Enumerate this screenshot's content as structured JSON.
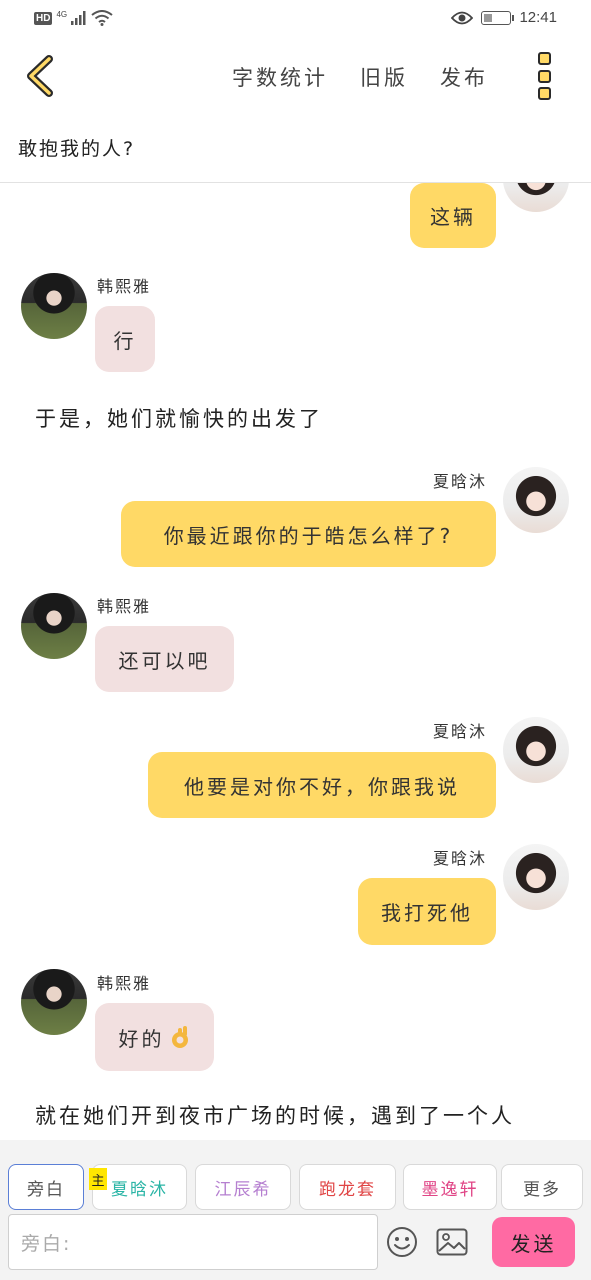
{
  "status_bar": {
    "hd": "HD",
    "network_type": "4G",
    "battery_level": 0.3,
    "battery_text": "31",
    "time": "12:41",
    "icons": [
      "signal-icon",
      "wifi-icon",
      "eye-icon",
      "battery-icon"
    ]
  },
  "top_bar": {
    "back_icon": "chevron-left-icon",
    "word_count_label": "字数统计",
    "old_version_label": "旧版",
    "publish_label": "发布",
    "more_icon": "more-vertical-icon"
  },
  "story": {
    "title": "敢抱我的人?"
  },
  "messages": [
    {
      "type": "bubble",
      "side": "right",
      "text": "这辆"
    },
    {
      "type": "bubble",
      "side": "left",
      "speaker": "韩熙雅",
      "text": "行"
    },
    {
      "type": "narration",
      "text": "于是，她们就愉快的出发了"
    },
    {
      "type": "bubble",
      "side": "right",
      "speaker": "夏晗沐",
      "text": "你最近跟你的于皓怎么样了?"
    },
    {
      "type": "bubble",
      "side": "left",
      "speaker": "韩熙雅",
      "text": "还可以吧"
    },
    {
      "type": "bubble",
      "side": "right",
      "speaker": "夏晗沐",
      "text": "他要是对你不好，你跟我说"
    },
    {
      "type": "bubble",
      "side": "right",
      "speaker": "夏晗沐",
      "text": "我打死他"
    },
    {
      "type": "bubble",
      "side": "left",
      "speaker": "韩熙雅",
      "text": "好的"
    },
    {
      "type": "narration",
      "text": "就在她们开到夜市广场的时候，遇到了一个人"
    }
  ],
  "characters": {
    "main_tag": "主",
    "items": [
      {
        "label": "旁白",
        "color": "#555555"
      },
      {
        "label": "夏晗沐",
        "color": "#2bb5a6"
      },
      {
        "label": "江辰希",
        "color": "#b57fd0"
      },
      {
        "label": "跑龙套",
        "color": "#e04545"
      },
      {
        "label": "墨逸轩",
        "color": "#e04586"
      },
      {
        "label": "更多",
        "color": "#555555"
      }
    ]
  },
  "composer": {
    "placeholder": "旁白:",
    "emoji_icon": "emoji-icon",
    "image_icon": "image-icon",
    "send_label": "发送",
    "send_color": "#ff6aa3"
  }
}
